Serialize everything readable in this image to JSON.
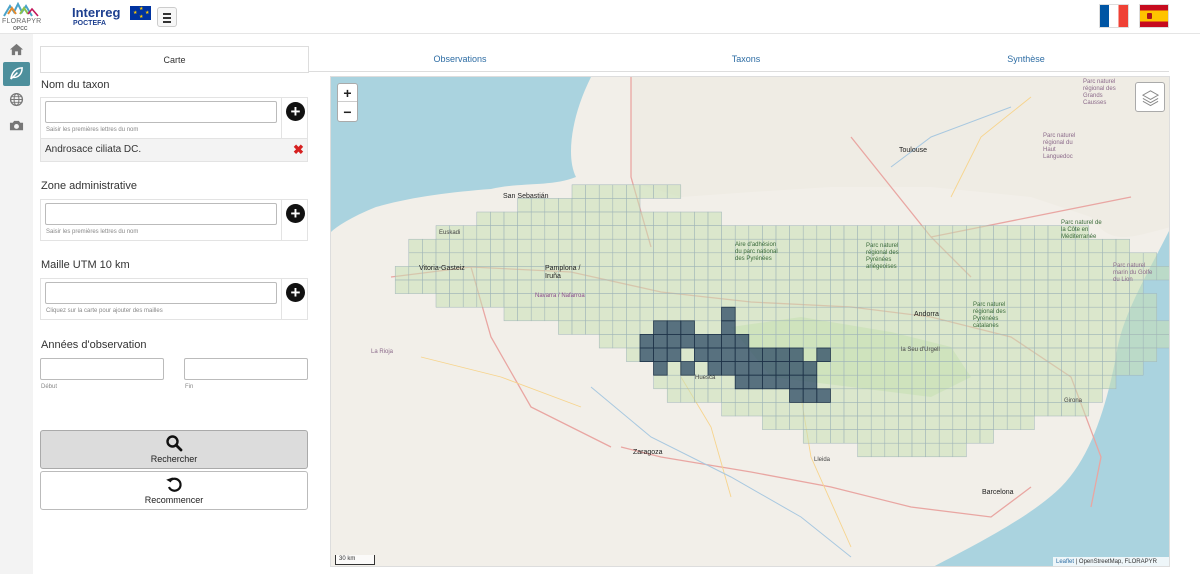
{
  "header": {
    "logo_text": "FLORAPYR",
    "logo_sub": "OPCC",
    "interreg": "Interreg",
    "poctefa": "POCTEFA",
    "languages": [
      "fr",
      "es"
    ]
  },
  "left_nav": {
    "items": [
      {
        "icon": "home-icon",
        "active": false
      },
      {
        "icon": "leaf-icon",
        "active": true
      },
      {
        "icon": "globe-icon",
        "active": false
      },
      {
        "icon": "camera-icon",
        "active": false
      }
    ]
  },
  "tabs": {
    "carte": "Carte",
    "observations": "Observations",
    "taxons": "Taxons",
    "synthese": "Synthèse"
  },
  "taxon": {
    "title": "Nom du taxon",
    "value": "",
    "help": "Saisir les premières lettres du nom",
    "selected": "Androsace ciliata DC."
  },
  "zone": {
    "title": "Zone administrative",
    "value": "",
    "help": "Saisir les premières lettres du nom"
  },
  "maille": {
    "title": "Maille UTM 10 km",
    "value": "",
    "help": "Cliquez sur la carte pour ajouter des mailles"
  },
  "annees": {
    "title": "Années d'observation",
    "debut_value": "",
    "fin_value": "",
    "debut_label": "Début",
    "fin_label": "Fin"
  },
  "buttons": {
    "rechercher": "Rechercher",
    "recommencer": "Recommencer"
  },
  "map": {
    "zoom_in": "+",
    "zoom_out": "−",
    "scale": "30 km",
    "attribution_leaflet": "Leaflet",
    "attribution_rest": " | OpenStreetMap, FLORAPYR",
    "labels": {
      "san_sebastian": "San Sebastián",
      "euskadi": "Euskadi",
      "vitoria": "Vitoria-Gasteiz",
      "pamplona": "Pamplona / Iruña",
      "navarra": "Navarra / Nafarroa",
      "toulouse": "Toulouse",
      "andorra": "Andorra",
      "zaragoza": "Zaragoza",
      "huesca": "Huesca",
      "lleida": "Lleida",
      "girona": "Girona",
      "barcelona": "Barcelona",
      "la_rioja": "La Rioja",
      "aire_adhesion": "Aire d'adhésion du parc national des Pyrénées",
      "pnr_ariegeoises": "Parc naturel régional des Pyrénées ariégeoises",
      "pnr_catalanes": "Parc naturel régional des Pyrénées catalanes",
      "pnr_grands_causses": "Parc naturel régional des Grands Causses",
      "pnr_haut_languedoc": "Parc naturel régional du Haut Languedoc",
      "pnm_golfe": "Parc naturel marin du Golfe du Lion",
      "pnm_cote": "Parc naturel de la Côte en Méditerranée",
      "la_seu": "la Seu d'Urgell",
      "llavorsi": "Lleida"
    }
  },
  "colors": {
    "accent": "#4d8f9c",
    "grid_fill": "#c8e0b4",
    "grid_stroke": "#9fb4b9",
    "selected_cell": "#2c4a66"
  },
  "grid": {
    "columns_start": 0,
    "selected_cells": [
      [
        21,
        14
      ],
      [
        22,
        14
      ],
      [
        23,
        14
      ],
      [
        26,
        13
      ],
      [
        26,
        14
      ],
      [
        20,
        15
      ],
      [
        21,
        15
      ],
      [
        22,
        15
      ],
      [
        23,
        15
      ],
      [
        24,
        15
      ],
      [
        25,
        15
      ],
      [
        26,
        15
      ],
      [
        27,
        15
      ],
      [
        20,
        16
      ],
      [
        21,
        16
      ],
      [
        22,
        16
      ],
      [
        24,
        16
      ],
      [
        25,
        16
      ],
      [
        26,
        16
      ],
      [
        27,
        16
      ],
      [
        28,
        16
      ],
      [
        29,
        16
      ],
      [
        30,
        16
      ],
      [
        31,
        16
      ],
      [
        33,
        16
      ],
      [
        21,
        17
      ],
      [
        23,
        17
      ],
      [
        25,
        17
      ],
      [
        26,
        17
      ],
      [
        27,
        17
      ],
      [
        28,
        17
      ],
      [
        29,
        17
      ],
      [
        30,
        17
      ],
      [
        31,
        17
      ],
      [
        32,
        17
      ],
      [
        27,
        18
      ],
      [
        28,
        18
      ],
      [
        29,
        18
      ],
      [
        30,
        18
      ],
      [
        31,
        18
      ],
      [
        32,
        18
      ],
      [
        31,
        19
      ],
      [
        32,
        19
      ],
      [
        33,
        19
      ]
    ]
  }
}
